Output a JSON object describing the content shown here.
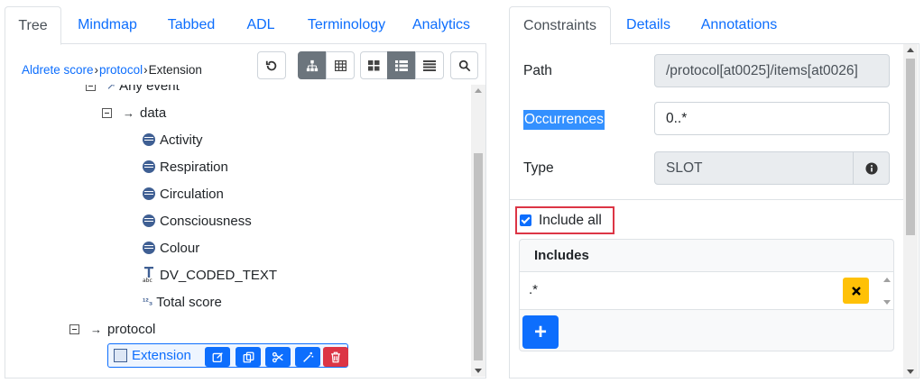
{
  "left_tabs": [
    "Tree",
    "Mindmap",
    "Tabbed",
    "ADL",
    "Terminology",
    "Analytics"
  ],
  "breadcrumb": {
    "items": [
      "Aldrete score",
      "protocol"
    ],
    "current": "Extension",
    "sep": "›"
  },
  "toolbar_icons": [
    "undo-icon",
    "hierarchy-icon",
    "table-icon",
    "grid-icon",
    "list-detail-icon",
    "list-icon",
    "search-icon"
  ],
  "tree": {
    "any_event": "Any event",
    "data": "data",
    "elements": [
      "Activity",
      "Respiration",
      "Circulation",
      "Consciousness",
      "Colour"
    ],
    "coded_text": "DV_CODED_TEXT",
    "total_score": "Total score",
    "protocol": "protocol",
    "selected": "Extension"
  },
  "right_tabs": [
    "Constraints",
    "Details",
    "Annotations"
  ],
  "constraints": {
    "path_label": "Path",
    "path_value": "/protocol[at0025]/items[at0026]",
    "occurrences_label": "Occurrences",
    "occurrences_value": "0..*",
    "type_label": "Type",
    "type_value": "SLOT",
    "include_all_label": "Include all",
    "include_all_checked": true,
    "includes_header": "Includes",
    "include_value": ".*",
    "add_button": "+"
  },
  "colors": {
    "primary": "#0d6efd",
    "warning": "#ffc107",
    "danger": "#dc3545",
    "secondary": "#6c757d"
  }
}
